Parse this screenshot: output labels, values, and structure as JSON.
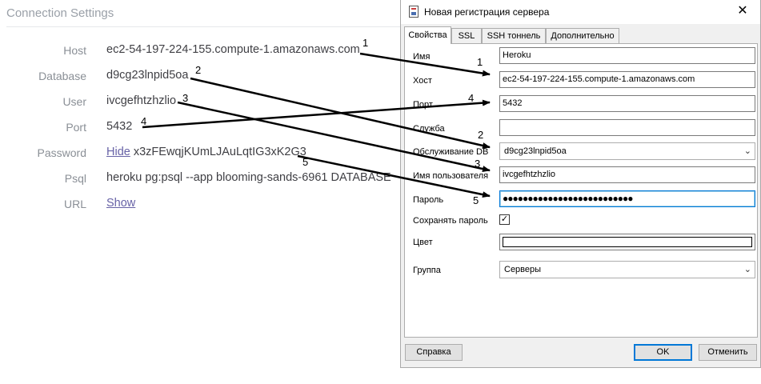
{
  "connection_settings": {
    "title": "Connection Settings",
    "rows": [
      {
        "label": "Host",
        "value": "ec2-54-197-224-155.compute-1.amazonaws.com"
      },
      {
        "label": "Database",
        "value": "d9cg23lnpid5oa"
      },
      {
        "label": "User",
        "value": "ivcgefhtzhzlio"
      },
      {
        "label": "Port",
        "value": "5432"
      },
      {
        "label": "Password",
        "value": "x3zFEwqjKUmLJAuLqtIG3xK2G3",
        "link": "Hide"
      },
      {
        "label": "Psql",
        "value": "heroku pg:psql --app blooming-sands-6961 DATABASE"
      },
      {
        "label": "URL",
        "value": "",
        "link": "Show"
      }
    ]
  },
  "dialog": {
    "title": "Новая регистрация сервера",
    "close": "✕",
    "tabs": [
      "Свойства",
      "SSL",
      "SSH тоннель",
      "Дополнительно"
    ],
    "active_tab": "Свойства",
    "fields": {
      "name": {
        "label": "Имя",
        "value": "Heroku"
      },
      "host": {
        "label": "Хост",
        "value": "ec2-54-197-224-155.compute-1.amazonaws.com"
      },
      "port": {
        "label": "Порт",
        "value": "5432"
      },
      "service": {
        "label": "Служба",
        "value": ""
      },
      "maintenance_db": {
        "label": "Обслуживание DB",
        "value": "d9cg23lnpid5oa"
      },
      "username": {
        "label": "Имя пользователя",
        "value": "ivcgefhtzhzlio"
      },
      "password": {
        "label": "Пароль",
        "value": "●●●●●●●●●●●●●●●●●●●●●●●●●●"
      },
      "save_password": {
        "label": "Сохранять пароль",
        "checked": true,
        "mark": "✓"
      },
      "color": {
        "label": "Цвет",
        "value": "#ffffff"
      },
      "group": {
        "label": "Группа",
        "value": "Серверы"
      }
    },
    "buttons": {
      "help": "Справка",
      "ok": "OK",
      "cancel": "Отменить"
    }
  },
  "annotations": [
    "1",
    "2",
    "3",
    "4",
    "5"
  ]
}
